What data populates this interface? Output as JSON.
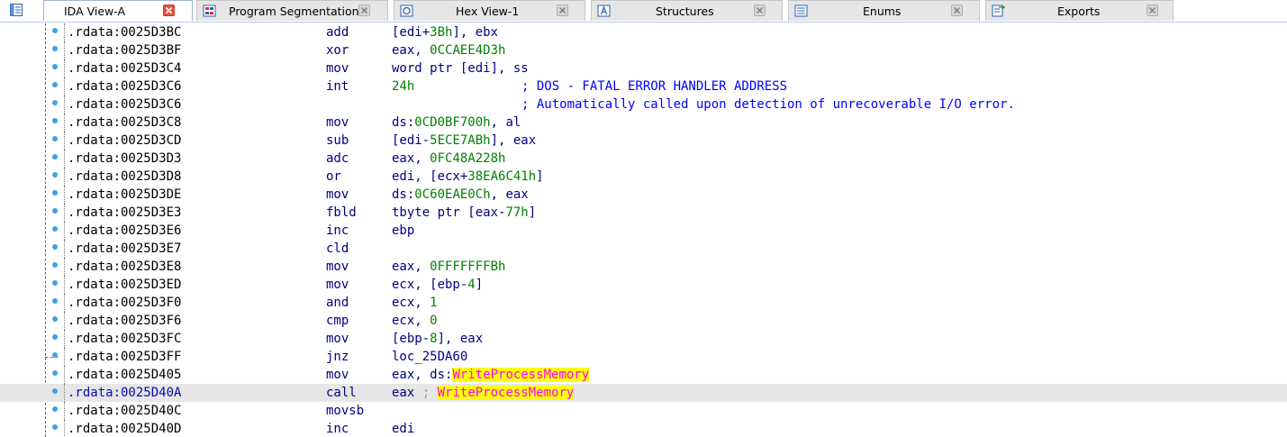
{
  "tabs": [
    {
      "label": "IDA View-A",
      "icon": "ida-view-icon",
      "active": true
    },
    {
      "label": "Program Segmentation",
      "icon": "segmentation-icon",
      "active": false
    },
    {
      "label": "Hex View-1",
      "icon": "hex-view-icon",
      "active": false
    },
    {
      "label": "Structures",
      "icon": "structures-icon",
      "active": false
    },
    {
      "label": "Enums",
      "icon": "enums-icon",
      "active": false
    },
    {
      "label": "Exports",
      "icon": "exports-icon",
      "active": false
    }
  ],
  "colors": {
    "mnemonic": "#000080",
    "number": "#008000",
    "comment": "#0000ff",
    "api_text": "#ff00ff",
    "api_highlight": "#ffff00",
    "current_line": "#e6e6e6",
    "flow_arrow": "#e0302a"
  },
  "listing": {
    "current_address": ".rdata:0025D40A",
    "lines": [
      {
        "addr": ".rdata:0025D3BC",
        "mnem": "add",
        "ops": "[edi+3Bh], ebx"
      },
      {
        "addr": ".rdata:0025D3BF",
        "mnem": "xor",
        "ops": "eax, 0CCAEE4D3h"
      },
      {
        "addr": ".rdata:0025D3C4",
        "mnem": "mov",
        "ops": "word ptr [edi], ss"
      },
      {
        "addr": ".rdata:0025D3C6",
        "mnem": "int",
        "ops": "24h",
        "comment": "; DOS - FATAL ERROR HANDLER ADDRESS"
      },
      {
        "addr": ".rdata:0025D3C6",
        "mnem": "",
        "ops": "",
        "comment": "; Automatically called upon detection of unrecoverable I/O error."
      },
      {
        "addr": ".rdata:0025D3C8",
        "mnem": "mov",
        "ops": "ds:0CD0BF700h, al"
      },
      {
        "addr": ".rdata:0025D3CD",
        "mnem": "sub",
        "ops": "[edi-5ECE7ABh], eax"
      },
      {
        "addr": ".rdata:0025D3D3",
        "mnem": "adc",
        "ops": "eax, 0FC48A228h"
      },
      {
        "addr": ".rdata:0025D3D8",
        "mnem": "or",
        "ops": "edi, [ecx+38EA6C41h]"
      },
      {
        "addr": ".rdata:0025D3DE",
        "mnem": "mov",
        "ops": "ds:0C60EAE0Ch, eax"
      },
      {
        "addr": ".rdata:0025D3E3",
        "mnem": "fbld",
        "ops": "tbyte ptr [eax-77h]"
      },
      {
        "addr": ".rdata:0025D3E6",
        "mnem": "inc",
        "ops": "ebp"
      },
      {
        "addr": ".rdata:0025D3E7",
        "mnem": "cld",
        "ops": ""
      },
      {
        "addr": ".rdata:0025D3E8",
        "mnem": "mov",
        "ops": "eax, 0FFFFFFFBh"
      },
      {
        "addr": ".rdata:0025D3ED",
        "mnem": "mov",
        "ops": "ecx, [ebp-4]"
      },
      {
        "addr": ".rdata:0025D3F0",
        "mnem": "and",
        "ops": "ecx, 1"
      },
      {
        "addr": ".rdata:0025D3F6",
        "mnem": "cmp",
        "ops": "ecx, 0"
      },
      {
        "addr": ".rdata:0025D3FC",
        "mnem": "mov",
        "ops": "[ebp-8], eax"
      },
      {
        "addr": ".rdata:0025D3FF",
        "mnem": "jnz",
        "ops": "loc_25DA60"
      },
      {
        "addr": ".rdata:0025D405",
        "mnem": "mov",
        "ops": "eax, ds:WriteProcessMemory"
      },
      {
        "addr": ".rdata:0025D40A",
        "mnem": "call",
        "ops": "eax ; WriteProcessMemory"
      },
      {
        "addr": ".rdata:0025D40C",
        "mnem": "movsb",
        "ops": ""
      },
      {
        "addr": ".rdata:0025D40D",
        "mnem": "inc",
        "ops": "edi"
      }
    ]
  }
}
